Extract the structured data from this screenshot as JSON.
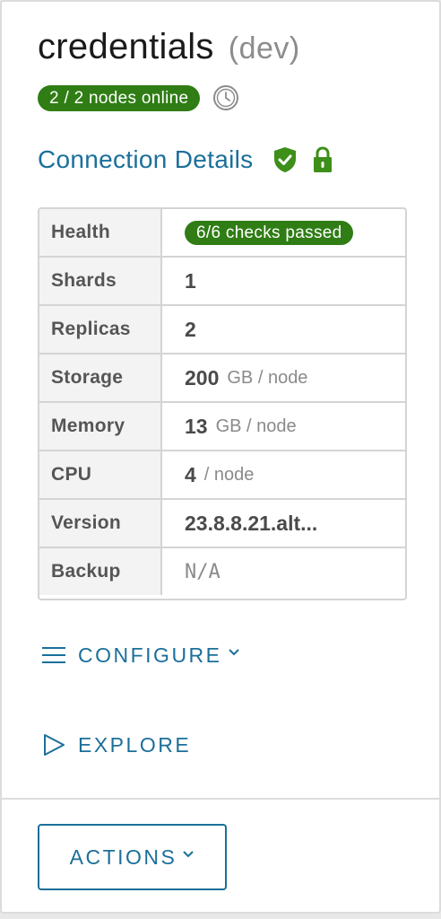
{
  "header": {
    "title": "credentials",
    "env": "(dev)",
    "nodes_status": "2 / 2 nodes online"
  },
  "connection": {
    "title": "Connection Details"
  },
  "details": {
    "health": {
      "label": "Health",
      "value": "6/6 checks passed"
    },
    "shards": {
      "label": "Shards",
      "value": "1"
    },
    "replicas": {
      "label": "Replicas",
      "value": "2"
    },
    "storage": {
      "label": "Storage",
      "value": "200",
      "unit": "GB / node"
    },
    "memory": {
      "label": "Memory",
      "value": "13",
      "unit": "GB / node"
    },
    "cpu": {
      "label": "CPU",
      "value": "4",
      "unit": "/ node"
    },
    "version": {
      "label": "Version",
      "value": "23.8.8.21.alt..."
    },
    "backup": {
      "label": "Backup",
      "value": "N/A"
    }
  },
  "nav": {
    "configure": "CONFIGURE",
    "explore": "EXPLORE"
  },
  "actions": {
    "label": "ACTIONS"
  },
  "icons": {
    "clock": "clock-icon",
    "shield": "shield-check-icon",
    "lock": "lock-icon",
    "menu": "hamburger-icon",
    "play": "play-icon",
    "chevron": "chevron-down-icon"
  },
  "colors": {
    "accent": "#1b6f9a",
    "success": "#2f7d14",
    "icon_green": "#3d8f19"
  }
}
